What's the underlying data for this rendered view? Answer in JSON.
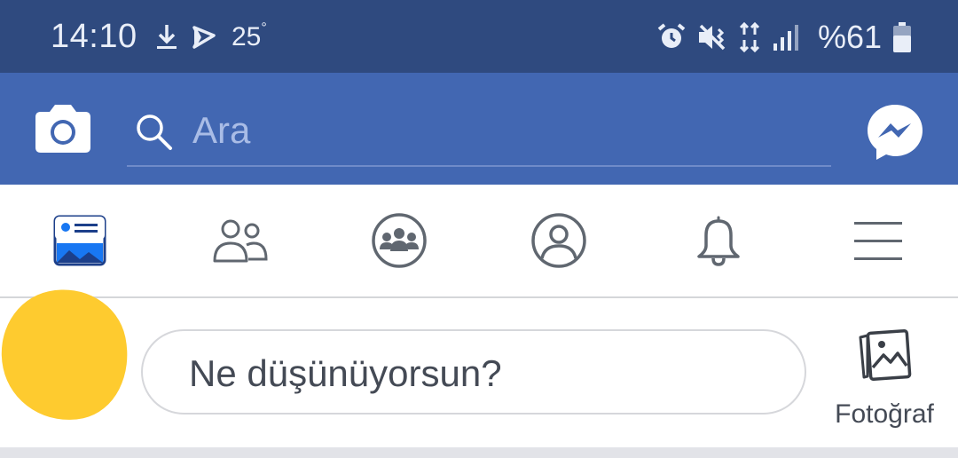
{
  "status_bar": {
    "time": "14:10",
    "temperature": "25",
    "temperature_unit": "°",
    "battery": "%61",
    "icons": [
      "download-icon",
      "navigation-icon",
      "alarm-icon",
      "vibrate-icon",
      "data-transfer-icon",
      "signal-icon",
      "battery-icon"
    ]
  },
  "app_bar": {
    "search_placeholder": "Ara",
    "icons": [
      "camera-icon",
      "search-icon",
      "messenger-icon"
    ],
    "color": "#4267b2"
  },
  "tabs": [
    {
      "name": "news-feed",
      "icon": "news-feed-icon",
      "active": true
    },
    {
      "name": "friends",
      "icon": "friends-icon",
      "active": false
    },
    {
      "name": "groups",
      "icon": "groups-icon",
      "active": false
    },
    {
      "name": "profile",
      "icon": "profile-icon",
      "active": false
    },
    {
      "name": "notifications",
      "icon": "bell-icon",
      "active": false
    },
    {
      "name": "menu",
      "icon": "menu-icon",
      "active": false
    }
  ],
  "composer": {
    "prompt": "Ne düşünüyorsun?",
    "photo_label": "Fotoğraf"
  },
  "colors": {
    "status_bar": "#2f4a7f",
    "app_bar": "#4267b2",
    "accent": "#1877f2",
    "icon_gray": "#606770",
    "avatar": "#fecb2f"
  }
}
